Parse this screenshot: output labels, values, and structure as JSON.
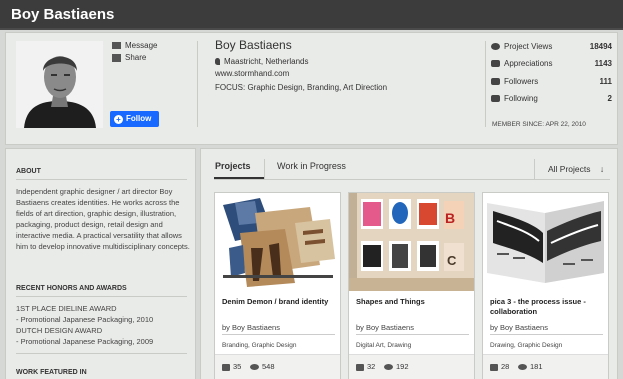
{
  "header": {
    "title": "Boy Bastiaens"
  },
  "profile": {
    "name": "Boy Bastiaens",
    "location": "Maastricht, Netherlands",
    "website": "www.stormhand.com",
    "focus": "FOCUS: Graphic Design, Branding, Art Direction",
    "actions": {
      "message": "Message",
      "share": "Share",
      "follow": "Follow"
    },
    "stats": [
      {
        "icon": "eye-icon",
        "label": "Project Views",
        "value": "18494"
      },
      {
        "icon": "thumbs-up-icon",
        "label": "Appreciations",
        "value": "1143"
      },
      {
        "icon": "person-icon",
        "label": "Followers",
        "value": "111"
      },
      {
        "icon": "person-icon",
        "label": "Following",
        "value": "2"
      }
    ],
    "member_since": "MEMBER SINCE: APR 22, 2010"
  },
  "sidebar": {
    "about_heading": "ABOUT",
    "about_text": "Independent graphic designer / art director Boy Bastiaens creates identities. He works across the fields of art direction, graphic design, illustration, packaging, product design, retail design and interactive media. A practical versatility that allows him to develop innovative multidisciplinary concepts.",
    "honors_heading": "RECENT HONORS AND AWARDS",
    "honors": [
      "1ST PLACE DIELINE AWARD",
      "- Promotional Japanese Packaging, 2010",
      "DUTCH DESIGN AWARD",
      "- Promotional Japanese Packaging, 2009"
    ],
    "featured_heading": "WORK FEATURED IN"
  },
  "main": {
    "tabs": [
      {
        "label": "Projects"
      },
      {
        "label": "Work in Progress"
      }
    ],
    "filter": "All Projects",
    "filter_icon": "down-arrow-icon",
    "projects": [
      {
        "title": "Denim Demon / brand identity",
        "by": "by  Boy Bastiaens",
        "tags": "Branding, Graphic Design",
        "appreciations": "35",
        "views": "548"
      },
      {
        "title": "Shapes and Things",
        "by": "by  Boy Bastiaens",
        "tags": "Digital Art, Drawing",
        "appreciations": "32",
        "views": "192"
      },
      {
        "title": "pica 3 - the process issue - collaboration",
        "by": "by  Boy Bastiaens",
        "tags": "Drawing, Graphic Design",
        "appreciations": "28",
        "views": "181"
      }
    ]
  },
  "colors": {
    "accent": "#1769ff",
    "topbar": "#3c3c3c",
    "panel": "#e9ebe8"
  }
}
